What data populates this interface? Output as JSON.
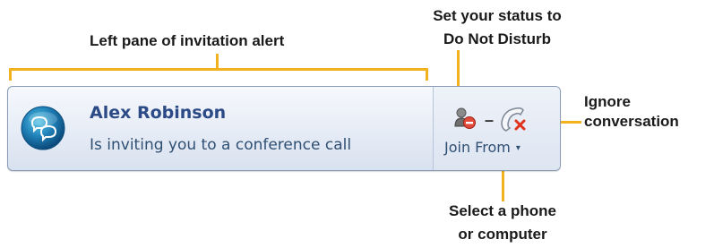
{
  "callouts": {
    "left_pane": "Left pane of invitation alert",
    "status": [
      "Set your status to",
      "Do Not Disturb"
    ],
    "ignore": [
      "Ignore",
      "conversation"
    ],
    "join": [
      "Select a phone",
      "or computer"
    ]
  },
  "alert": {
    "caller_name": "Alex Robinson",
    "message": "Is inviting you to a conference call",
    "join_label": "Join From",
    "join_chevron": "▾",
    "dash": "–"
  },
  "icons": {
    "avatar": "conference-people-icon",
    "status": "do-not-disturb-icon",
    "ignore": "ignore-phone-icon"
  },
  "colors": {
    "callout_line": "#f2b21f",
    "name_text": "#2b4a86",
    "body_text": "#2f4f73"
  }
}
